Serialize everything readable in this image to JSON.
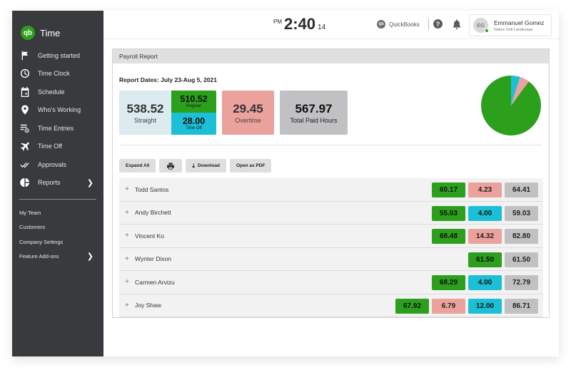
{
  "app": {
    "name": "Time",
    "logo_text": "qb"
  },
  "sidebar": {
    "items": [
      {
        "label": "Getting started",
        "icon": "flag-icon"
      },
      {
        "label": "Time Clock",
        "icon": "clock-icon"
      },
      {
        "label": "Schedule",
        "icon": "calendar-icon"
      },
      {
        "label": "Who's Working",
        "icon": "location-pin-icon"
      },
      {
        "label": "Time Entries",
        "icon": "time-entries-icon"
      },
      {
        "label": "Time Off",
        "icon": "airplane-icon"
      },
      {
        "label": "Approvals",
        "icon": "double-check-icon"
      },
      {
        "label": "Reports",
        "icon": "pie-chart-icon",
        "has_submenu": true
      }
    ],
    "secondary_items": [
      {
        "label": "My Team"
      },
      {
        "label": "Customers"
      },
      {
        "label": "Company Settings"
      },
      {
        "label": "Feature Add-ons",
        "has_submenu": true
      }
    ]
  },
  "topbar": {
    "clock": {
      "ampm": "PM",
      "time": "2:40",
      "seconds": "14"
    },
    "quickbooks_label": "QuickBooks",
    "quickbooks_icon_text": "qb",
    "help_icon_text": "?",
    "user": {
      "initials": "EG",
      "name": "Emmanuel Gomez",
      "company": "Native Soil Landscape",
      "status": "online"
    }
  },
  "report": {
    "title": "Payroll Report",
    "dates": "Report Dates: July 23-Aug 5, 2021",
    "summary": {
      "straight": {
        "value": "538.52",
        "label": "Straight"
      },
      "regular": {
        "value": "510.52",
        "label": "Regular"
      },
      "time_off": {
        "value": "28.00",
        "label": "Time Off"
      },
      "overtime": {
        "value": "29.45",
        "label": "Overtime"
      },
      "total": {
        "value": "567.97",
        "label": "Total Paid Hours"
      }
    },
    "toolbar": {
      "expand_all": "Expand All",
      "print_icon": "printer-icon",
      "download": "Download",
      "open_pdf": "Open as PDF"
    },
    "employees": [
      {
        "name": "Todd Santos",
        "cells": [
          {
            "type": "reg",
            "value": "60.17"
          },
          {
            "type": "ot",
            "value": "4.23"
          },
          {
            "type": "tot",
            "value": "64.41"
          }
        ]
      },
      {
        "name": "Andy Birchett",
        "cells": [
          {
            "type": "reg",
            "value": "55.03"
          },
          {
            "type": "off",
            "value": "4.00"
          },
          {
            "type": "tot",
            "value": "59.03"
          }
        ]
      },
      {
        "name": "Vincent Ko",
        "cells": [
          {
            "type": "reg",
            "value": "68.48"
          },
          {
            "type": "ot",
            "value": "14.32"
          },
          {
            "type": "tot",
            "value": "82.80"
          }
        ]
      },
      {
        "name": "Wynter Dixon",
        "cells": [
          {
            "type": "reg",
            "value": "61.50"
          },
          {
            "type": "tot",
            "value": "61.50"
          }
        ]
      },
      {
        "name": "Carmen Arvizu",
        "cells": [
          {
            "type": "reg",
            "value": "68.29"
          },
          {
            "type": "off",
            "value": "4.00"
          },
          {
            "type": "tot",
            "value": "72.79"
          }
        ]
      },
      {
        "name": "Joy Shaw",
        "cells": [
          {
            "type": "reg",
            "value": "67.92"
          },
          {
            "type": "ot",
            "value": "6.79"
          },
          {
            "type": "off",
            "value": "12.00"
          },
          {
            "type": "tot",
            "value": "86.71"
          }
        ]
      }
    ],
    "expand_symbol": "+"
  },
  "colors": {
    "regular": "#2ca01c",
    "time_off": "#1bc0d6",
    "overtime": "#eca29c",
    "total": "#c1c1c3",
    "straight_bg": "#dcebf0",
    "sidebar_bg": "#393a3d"
  },
  "chart_data": {
    "type": "pie",
    "title": "",
    "slices": [
      {
        "label": "Time Off",
        "value": 28.0,
        "color": "#1bc0d6"
      },
      {
        "label": "Overtime",
        "value": 29.45,
        "color": "#eca29c"
      },
      {
        "label": "Regular",
        "value": 510.52,
        "color": "#2ca01c"
      }
    ],
    "start_angle": "12 o'clock",
    "direction": "clockwise",
    "legend": "none"
  }
}
